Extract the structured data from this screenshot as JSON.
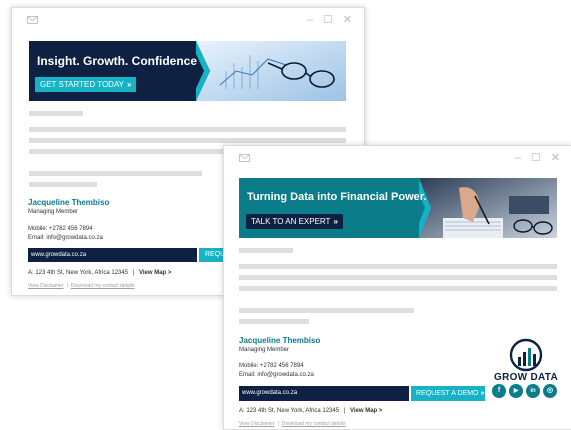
{
  "window1": {
    "icon": "mail-icon",
    "banner": {
      "title": "Insight. Growth. Confidence",
      "cta": "GET STARTED TODAY"
    },
    "signature": {
      "name": "Jacqueline Thembiso",
      "role": "Managing Member",
      "mobile": "Mobile: +2782 456 7894",
      "email": "Email: info@growdata.co.za",
      "url": "www.growdata.co.za",
      "button_partial": "REQU",
      "address": "A: 123 4th St, New York, Africa 12345",
      "address_sep": "|",
      "view_map": "View Map >",
      "disclaimer": "View Disclaimer",
      "download": "Download my contact details",
      "link_sep": "|"
    }
  },
  "window2": {
    "icon": "mail-icon",
    "banner": {
      "title": "Turning Data into Financial Power.",
      "cta": "TALK TO AN EXPERT"
    },
    "signature": {
      "name": "Jacqueline Thembiso",
      "role": "Managing Member",
      "mobile": "Mobile: +2782 456 7894",
      "email": "Email: info@growdata.co.za",
      "url": "www.growdata.co.za",
      "button": "REQUEST A DEMO",
      "address": "A: 123 4th St, New York, Africa 12345",
      "address_sep": "|",
      "view_map": "View Map >",
      "disclaimer": "View Disclaimer",
      "download": "Download my contact details",
      "link_sep": "|"
    },
    "logo": {
      "text": "GROW DATA"
    },
    "socials": [
      {
        "icon": "facebook-icon",
        "glyph": "f"
      },
      {
        "icon": "youtube-icon",
        "glyph": "▶"
      },
      {
        "icon": "linkedin-icon",
        "glyph": "in"
      },
      {
        "icon": "instagram-icon",
        "glyph": "◎"
      }
    ]
  },
  "window_controls": {
    "minimize": "–",
    "maximize": "☐",
    "close": "✕"
  },
  "colors": {
    "navy": "#0e2142",
    "teal": "#0a7c8a",
    "cyan": "#16b3c6"
  }
}
